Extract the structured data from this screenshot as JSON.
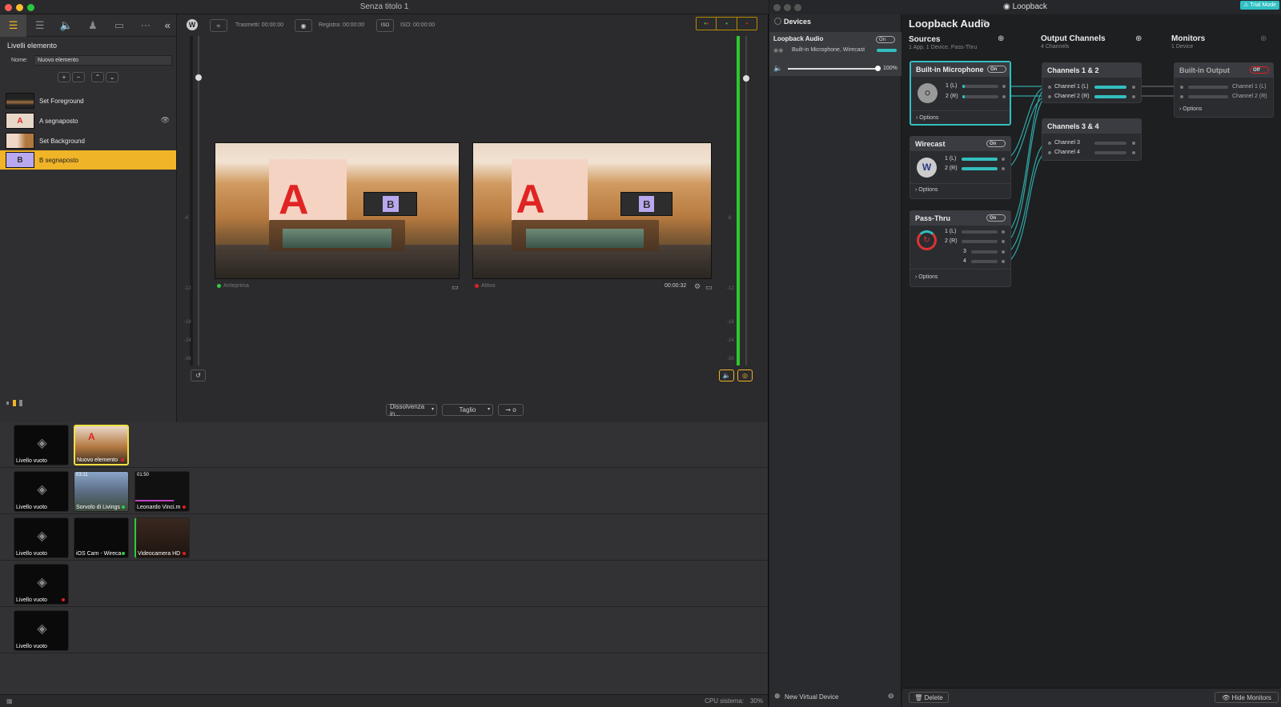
{
  "wirecast": {
    "window_title": "Senza titolo 1",
    "layers_title": "Livelli elemento",
    "name_label": "Nome:",
    "name_value": "Nuovo elemento",
    "layers": [
      "Set Foreground",
      "A segnaposto",
      "Set Background",
      "B segnaposto"
    ],
    "broadcast": "Trasmetti: 00:00:00",
    "record": "Registra: 00:00:00",
    "iso": "ISO: 00:00:00",
    "preview_label": "Anteprima",
    "live_label": "Attivo",
    "live_time": "00:00:32",
    "transition1": "Dissolvenza in...",
    "transition2": "Taglio",
    "go_label": "o",
    "cpu": "CPU sistema:",
    "cpu_value": "30%",
    "meter_ticks": [
      "-6",
      "-12",
      "-18",
      "-24",
      "-36"
    ],
    "shots": {
      "row1": [
        "Livello vuoto",
        "Nuovo elemento"
      ],
      "row2": [
        "Livello vuoto",
        "Sorvolo di Livings",
        "Leonardo Vinci.m"
      ],
      "row2_times": [
        "03:11",
        "01:50"
      ],
      "row3": [
        "Livello vuoto",
        "iOS Cam - Wireca",
        "Videocamera HD"
      ],
      "row4": [
        "Livello vuoto"
      ],
      "row5": [
        "Livello vuoto"
      ]
    }
  },
  "loopback": {
    "window_title": "Loopback",
    "trial": "Trial Mode",
    "devices_title": "Devices",
    "device_name": "Loopback Audio",
    "device_toggle": "On",
    "device_sources": "Built-in Microphone, Wirecast",
    "volume": "100%",
    "new_device": "New Virtual Device",
    "app_title": "Loopback Audio",
    "sources_title": "Sources",
    "sources_sub": "1 App, 1 Device, Pass-Thru",
    "output_title": "Output Channels",
    "output_sub": "4 Channels",
    "monitors_title": "Monitors",
    "monitors_sub": "1 Device",
    "src1": {
      "name": "Built-in Microphone",
      "toggle": "On",
      "ch": [
        "1 (L)",
        "2 (R)"
      ],
      "options": "Options"
    },
    "src2": {
      "name": "Wirecast",
      "toggle": "On",
      "ch": [
        "1 (L)",
        "2 (R)"
      ],
      "options": "Options"
    },
    "src3": {
      "name": "Pass-Thru",
      "toggle": "On",
      "ch": [
        "1 (L)",
        "2 (R)",
        "3",
        "4"
      ],
      "options": "Options"
    },
    "out1": {
      "name": "Channels 1 & 2",
      "ch": [
        "Channel 1 (L)",
        "Channel 2 (R)"
      ]
    },
    "out2": {
      "name": "Channels 3 & 4",
      "ch": [
        "Channel 3",
        "Channel 4"
      ]
    },
    "mon1": {
      "name": "Built-in Output",
      "toggle": "Off",
      "ch": [
        "Channel 1 (L)",
        "Channel 2 (R)"
      ],
      "options": "Options"
    },
    "delete": "Delete",
    "hide_monitors": "Hide Monitors",
    "colors": {
      "accent": "#33bfbf",
      "trial": "#2fc0c4",
      "selected_layer": "#f0b428"
    }
  }
}
